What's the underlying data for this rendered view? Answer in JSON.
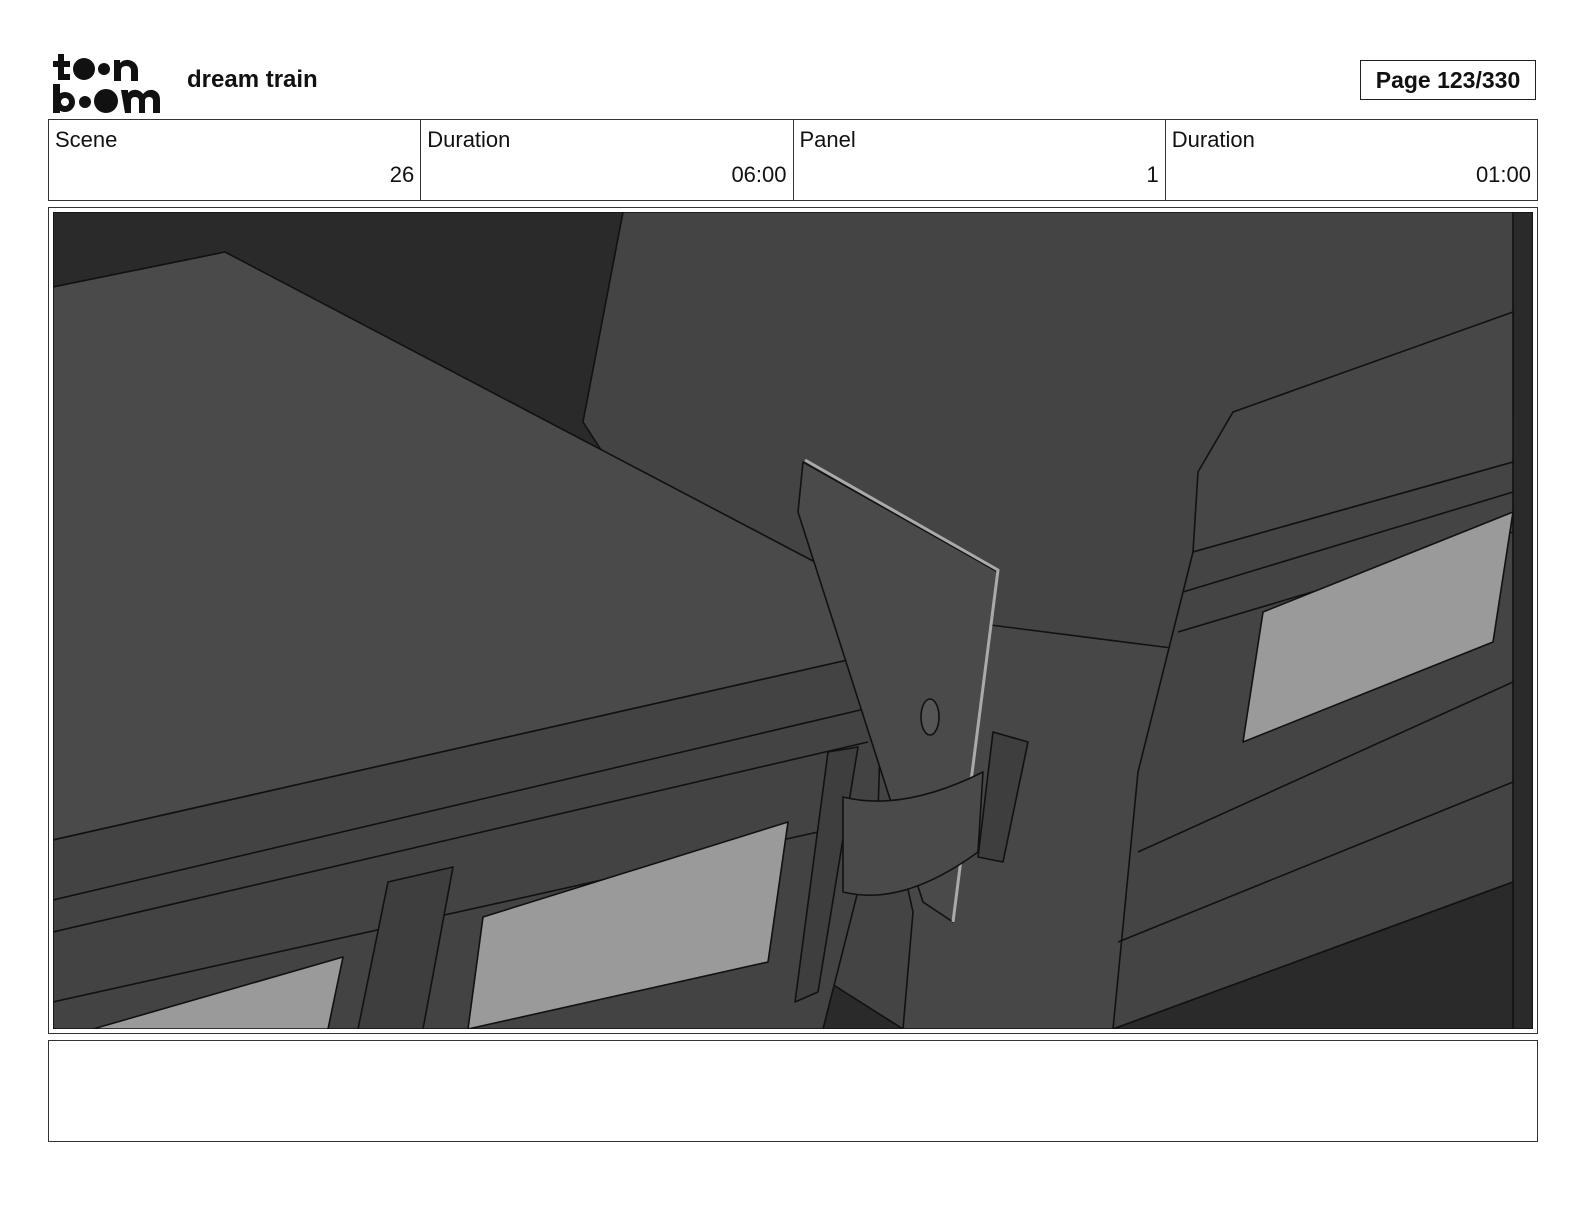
{
  "header": {
    "logo_text": "toon boom",
    "project_title": "dream train",
    "page_label": "Page 123/330"
  },
  "info": {
    "scene_label": "Scene",
    "scene_value": "26",
    "scene_duration_label": "Duration",
    "scene_duration_value": "06:00",
    "panel_label": "Panel",
    "panel_value": "1",
    "panel_duration_label": "Duration",
    "panel_duration_value": "01:00"
  },
  "panel": {
    "description": ""
  },
  "colors": {
    "frame_border": "#333333",
    "shadow": "#2a2a2a",
    "car_body": "#484848",
    "window_glass": "#999999"
  }
}
